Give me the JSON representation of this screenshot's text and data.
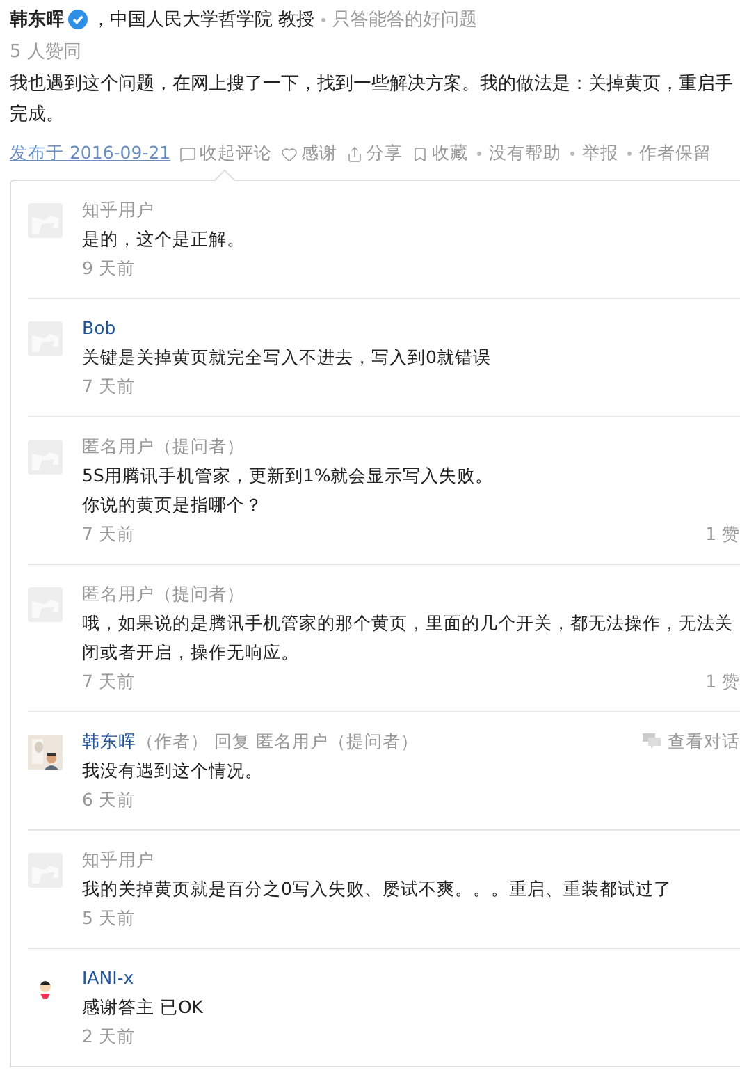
{
  "author": {
    "name": "韩东晖",
    "verified": true,
    "headline": "，中国人民大学哲学院 教授",
    "bio": "只答能答的好问题"
  },
  "votes": "5 人赞同",
  "answer_lines": [
    "我也遇到这个问题，在网上搜了一下，找到一些解决方案。我的做法是：关掉黄页，重启手",
    "完成。"
  ],
  "actions": [
    {
      "kind": "date",
      "label": "发布于 2016-09-21"
    },
    {
      "kind": "comment",
      "label": "收起评论"
    },
    {
      "kind": "thanks",
      "label": "感谢"
    },
    {
      "kind": "share",
      "label": "分享"
    },
    {
      "kind": "bookmark",
      "label": "收藏"
    },
    {
      "kind": "dot",
      "label": "没有帮助"
    },
    {
      "kind": "dot",
      "label": "举报"
    },
    {
      "kind": "dot",
      "label": "作者保留"
    }
  ],
  "comments": [
    {
      "kind": "default",
      "name": "知乎用户",
      "linked": false,
      "lines": [
        "是的，这个是正解。"
      ],
      "time": "9 天前"
    },
    {
      "kind": "default",
      "name": "Bob",
      "linked": true,
      "lines": [
        "关键是关掉黄页就完全写入不进去，写入到0就错误"
      ],
      "time": "7 天前"
    },
    {
      "kind": "default",
      "name": "匿名用户（提问者）",
      "linked": false,
      "lines": [
        "5S用腾讯手机管家，更新到1%就会显示写入失败。",
        "你说的黄页是指哪个？"
      ],
      "time": "7 天前",
      "likes": "1 赞"
    },
    {
      "kind": "default",
      "name": "匿名用户（提问者）",
      "linked": false,
      "lines": [
        "哦，如果说的是腾讯手机管家的那个黄页，里面的几个开关，都无法操作，无法关",
        "闭或者开启，操作无响应。"
      ],
      "time": "7 天前",
      "likes": "1 赞"
    },
    {
      "name": "韩东晖",
      "linked": true,
      "role": "（作者）",
      "reply_label": "回复",
      "reply_to": "匿名用户（提问者）",
      "conversation": "查看对话",
      "lines": [
        "我没有遇到这个情况。"
      ],
      "time": "6 天前"
    },
    {
      "kind": "default",
      "name": "知乎用户",
      "linked": false,
      "lines": [
        "我的关掉黄页就是百分之0写入失败、屡试不爽。。。重启、重装都试过了"
      ],
      "time": "5 天前"
    },
    {
      "kind": "cartoon",
      "name": "IANI-x",
      "linked": true,
      "lines": [
        "感谢答主 已OK"
      ],
      "time": "2 天前"
    }
  ]
}
